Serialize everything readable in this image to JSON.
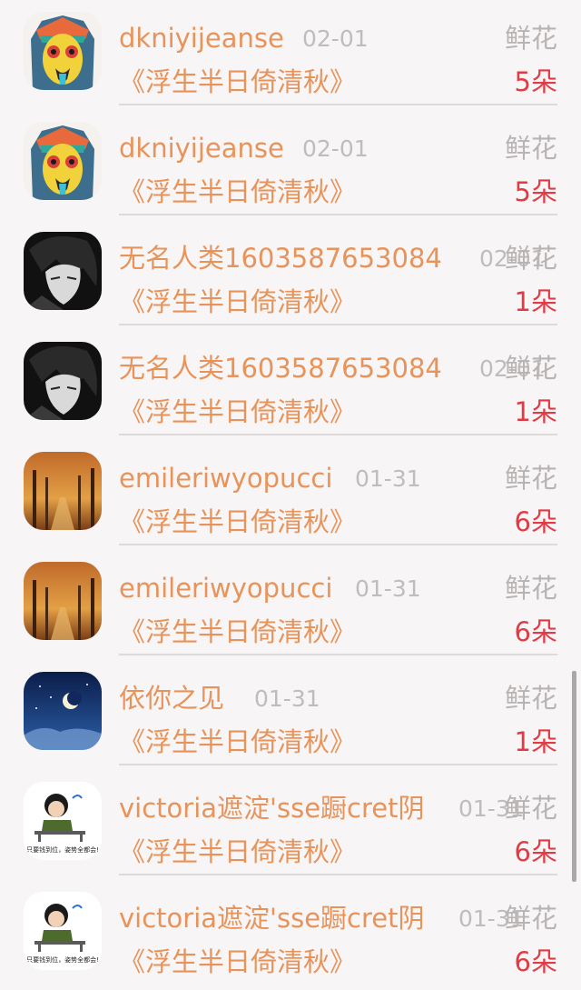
{
  "rows": [
    {
      "name": "dkniyijeanse",
      "date": "02-01",
      "gift_label": "鲜花",
      "book": "《浮生半日倚清秋》",
      "count": "5朵",
      "avatar": "tribal-face-avatar"
    },
    {
      "name": "dkniyijeanse",
      "date": "02-01",
      "gift_label": "鲜花",
      "book": "《浮生半日倚清秋》",
      "count": "5朵",
      "avatar": "tribal-face-avatar"
    },
    {
      "name": "无名人类1603587653084",
      "date": "02-01",
      "gift_label": "鲜花",
      "book": "《浮生半日倚清秋》",
      "count": "1朵",
      "avatar": "anime-boy-avatar"
    },
    {
      "name": "无名人类1603587653084",
      "date": "02-01",
      "gift_label": "鲜花",
      "book": "《浮生半日倚清秋》",
      "count": "1朵",
      "avatar": "anime-boy-avatar"
    },
    {
      "name": "emileriwyopucci",
      "date": "01-31",
      "gift_label": "鲜花",
      "book": "《浮生半日倚清秋》",
      "count": "6朵",
      "avatar": "autumn-forest-avatar"
    },
    {
      "name": "emileriwyopucci",
      "date": "01-31",
      "gift_label": "鲜花",
      "book": "《浮生半日倚清秋》",
      "count": "6朵",
      "avatar": "autumn-forest-avatar"
    },
    {
      "name": "依你之见",
      "date": "01-31",
      "gift_label": "鲜花",
      "book": "《浮生半日倚清秋》",
      "count": "1朵",
      "avatar": "night-moon-avatar"
    },
    {
      "name": "victoria遮淀'sse蹰cret阴",
      "date": "01-31",
      "gift_label": "鲜花",
      "book": "《浮生半日倚清秋》",
      "count": "6朵",
      "avatar": "cartoon-desk-avatar",
      "avatar_caption": "只要钱到位，姿势全都会!"
    },
    {
      "name": "victoria遮淀'sse蹰cret阴",
      "date": "01-31",
      "gift_label": "鲜花",
      "book": "《浮生半日倚清秋》",
      "count": "6朵",
      "avatar": "cartoon-desk-avatar",
      "avatar_caption": "只要钱到位，姿势全都会!"
    }
  ]
}
